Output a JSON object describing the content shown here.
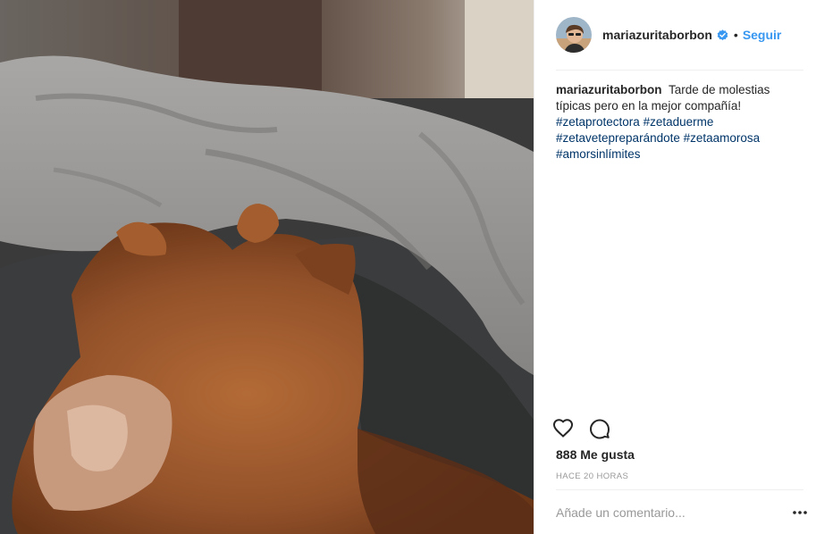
{
  "post": {
    "image": {
      "subject": "dog-sleeping-under-blanket"
    },
    "header": {
      "username": "mariazuritaborbon",
      "verified": true,
      "separator": "•",
      "follow_label": "Seguir"
    },
    "caption": {
      "username": "mariazuritaborbon",
      "text": "Tarde de molestias típicas pero en la mejor compañía!",
      "hashtags": [
        "#zetaprotectora",
        "#zetaduerme",
        "#zetavetepreparándote",
        "#zetaamorosa",
        "#amorsinlímites"
      ]
    },
    "actions": {
      "like_icon": "heart-icon",
      "comment_icon": "comment-icon"
    },
    "likes": "888 Me gusta",
    "timestamp": "HACE 20 HORAS",
    "comment": {
      "placeholder": "Añade un comentario...",
      "more_icon": "more-options-icon"
    },
    "colors": {
      "link": "#003569",
      "follow": "#3897f0",
      "text": "#262626",
      "muted": "#999999"
    }
  }
}
